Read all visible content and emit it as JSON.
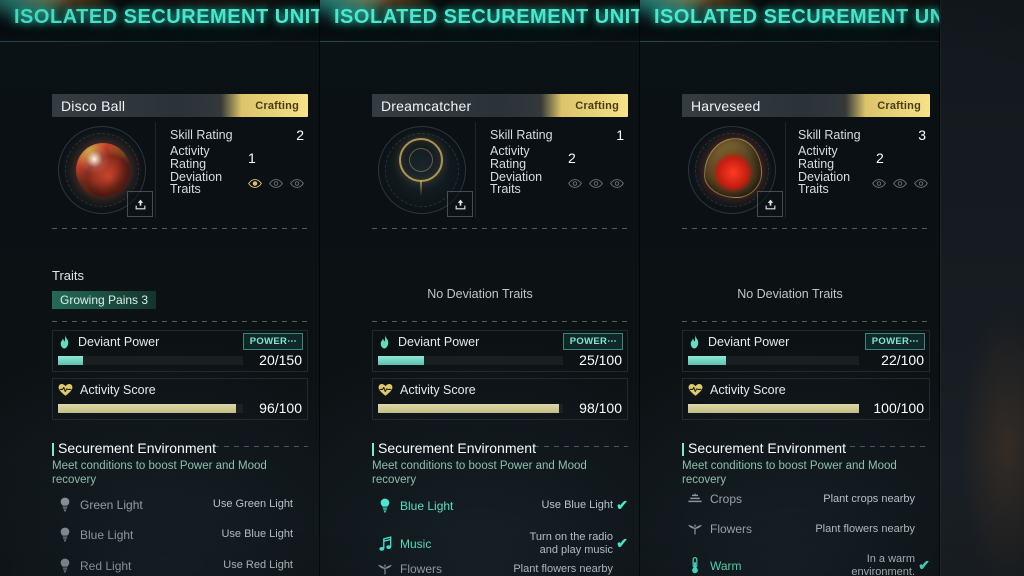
{
  "panels": [
    {
      "header_title": "ISOLATED SECUREMENT UNIT",
      "item_name": "Disco Ball",
      "status_label": "Crafting",
      "thumb_kind": "disco",
      "stats": [
        {
          "label": "Skill Rating",
          "value": "2"
        },
        {
          "label": "Activity Rating",
          "value": "1"
        },
        {
          "label": "Deviation Traits",
          "value": ""
        }
      ],
      "deviation_eyes": [
        true,
        false,
        false
      ],
      "traits_heading": "Traits",
      "trait_chips": [
        "Growing Pains 3"
      ],
      "no_deviation_text": "",
      "power": {
        "label": "Deviant Power",
        "pill": "POWER⋯",
        "value_text": "20/150",
        "current": 20,
        "max": 150
      },
      "activity": {
        "label": "Activity Score",
        "value_text": "96/100",
        "current": 96,
        "max": 100
      },
      "env_title": "Securement Environment",
      "env_desc": "Meet conditions to boost Power and Mood recovery",
      "conditions": [
        {
          "icon": "bulb-icon",
          "name": "Green Light",
          "desc": "Use Green Light",
          "met": false
        },
        {
          "icon": "bulb-icon",
          "name": "Blue Light",
          "desc": "Use Blue Light",
          "met": false
        },
        {
          "icon": "bulb-icon",
          "name": "Red Light",
          "desc": "Use Red Light",
          "met": false
        }
      ]
    },
    {
      "header_title": "ISOLATED SECUREMENT UNIT",
      "item_name": "Dreamcatcher",
      "status_label": "Crafting",
      "thumb_kind": "dream",
      "stats": [
        {
          "label": "Skill Rating",
          "value": "1"
        },
        {
          "label": "Activity Rating",
          "value": "2"
        },
        {
          "label": "Deviation Traits",
          "value": ""
        }
      ],
      "deviation_eyes": [
        false,
        false,
        false
      ],
      "traits_heading": "",
      "trait_chips": [],
      "no_deviation_text": "No Deviation Traits",
      "power": {
        "label": "Deviant Power",
        "pill": "POWER⋯",
        "value_text": "25/100",
        "current": 25,
        "max": 100
      },
      "activity": {
        "label": "Activity Score",
        "value_text": "98/100",
        "current": 98,
        "max": 100
      },
      "env_title": "Securement Environment",
      "env_desc": "Meet conditions to boost Power and Mood recovery",
      "conditions": [
        {
          "icon": "bulb-icon",
          "name": "Blue Light",
          "desc": "Use Blue Light",
          "met": true
        },
        {
          "icon": "music-note-icon",
          "name": "Music",
          "desc": "Turn on the radio and play music",
          "met": true
        },
        {
          "icon": "flower-icon",
          "name": "Flowers",
          "desc": "Plant flowers nearby",
          "met": false
        }
      ]
    },
    {
      "header_title": "ISOLATED SECUREMENT UNIT",
      "item_name": "Harveseed",
      "status_label": "Crafting",
      "thumb_kind": "seed",
      "stats": [
        {
          "label": "Skill Rating",
          "value": "3"
        },
        {
          "label": "Activity Rating",
          "value": "2"
        },
        {
          "label": "Deviation Traits",
          "value": ""
        }
      ],
      "deviation_eyes": [
        false,
        false,
        false
      ],
      "traits_heading": "",
      "trait_chips": [],
      "no_deviation_text": "No Deviation Traits",
      "power": {
        "label": "Deviant Power",
        "pill": "POWER⋯",
        "value_text": "22/100",
        "current": 22,
        "max": 100
      },
      "activity": {
        "label": "Activity Score",
        "value_text": "100/100",
        "current": 100,
        "max": 100
      },
      "env_title": "Securement Environment",
      "env_desc": "Meet conditions to boost Power and Mood recovery",
      "conditions": [
        {
          "icon": "crops-icon",
          "name": "Crops",
          "desc": "Plant crops nearby",
          "met": false
        },
        {
          "icon": "flower-icon",
          "name": "Flowers",
          "desc": "Plant flowers nearby",
          "met": false
        },
        {
          "icon": "thermometer-icon",
          "name": "Warm",
          "desc": "In a warm environment.",
          "met": true
        }
      ]
    }
  ],
  "colors": {
    "accent_teal": "#49e8cf",
    "gold": "#e6cd6e",
    "power_fill": "#7fe0c9",
    "activity_fill": "#cdc894",
    "met_text": "#55e0bd"
  }
}
